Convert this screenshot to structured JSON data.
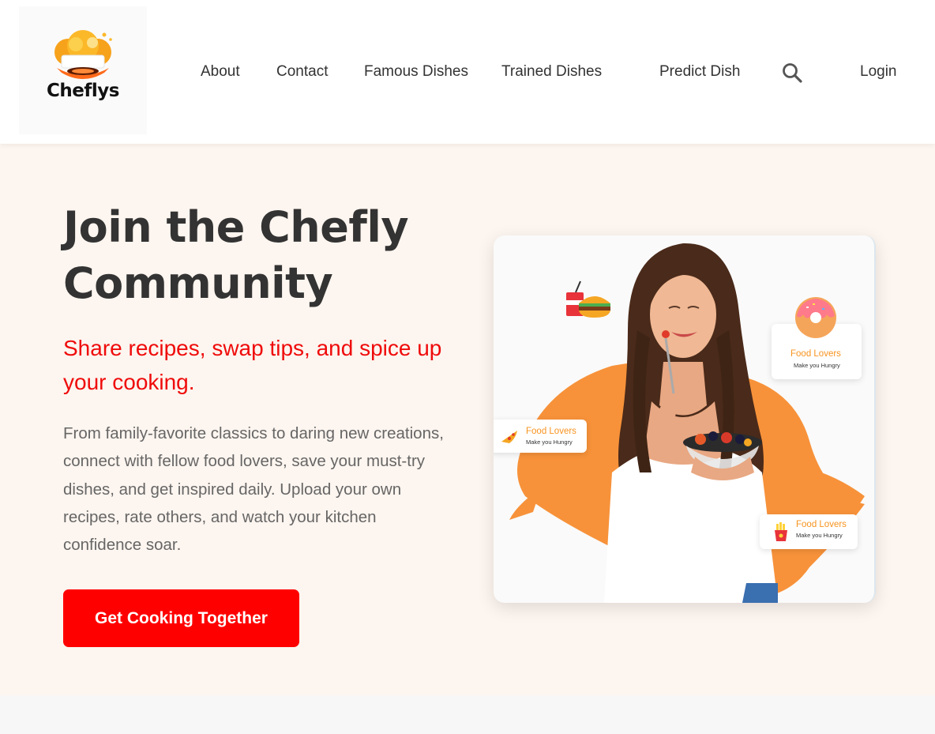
{
  "brand": {
    "name": "Cheflys"
  },
  "nav": {
    "about": "About",
    "contact": "Contact",
    "famous_dishes": "Famous Dishes",
    "trained_dishes": "Trained Dishes",
    "predict_dish": "Predict Dish",
    "search_icon": "search-icon",
    "login": "Login"
  },
  "hero": {
    "title": "Join the Chefly Community",
    "subtitle": "Share recipes, swap tips, and spice up your cooking.",
    "description": "From family-favorite classics to daring new creations, connect with fellow food lovers, save your must-try dishes, and get inspired daily. Upload your own recipes, rate others, and watch your kitchen confidence soar.",
    "cta_label": "Get Cooking Together"
  },
  "image_badges": [
    {
      "title": "Food Lovers",
      "subtitle": "Make you Hungry",
      "icon": "donut-icon"
    },
    {
      "title": "Food Lovers",
      "subtitle": "Make you Hungry",
      "icon": "pizza-icon"
    },
    {
      "title": "Food Lovers",
      "subtitle": "Make you Hungry",
      "icon": "fries-icon"
    }
  ],
  "colors": {
    "accent": "#ff0000",
    "subtitle": "#ef0b0b",
    "hero_bg": "#fdf5ef",
    "splash": "#f7923a"
  }
}
